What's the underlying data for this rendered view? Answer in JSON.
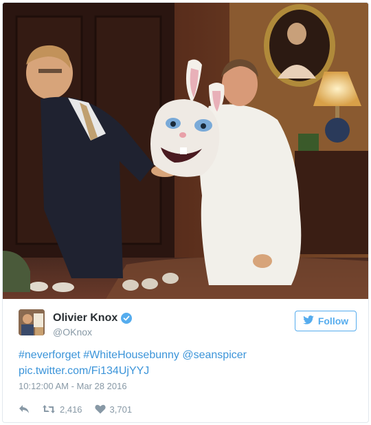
{
  "tweet": {
    "author": {
      "display_name": "Olivier Knox",
      "handle": "@OKnox",
      "verified": true,
      "avatar_icon": "profile-photo"
    },
    "follow_label": "Follow",
    "text": {
      "line1": "#neverforget #WhiteHousebunny @seanspicer",
      "line2": "pic.twitter.com/Fi134UjYYJ"
    },
    "timestamp": "10:12:00 AM - Mar 28 2016",
    "retweets": "2,416",
    "likes": "3,701"
  },
  "icons": {
    "reply": "reply-icon",
    "retweet": "retweet-icon",
    "like": "heart-icon",
    "verified": "verified-badge-icon",
    "twitter_bird": "twitter-bird-icon"
  },
  "colors": {
    "link": "#3b94d9",
    "follow_accent": "#55acee",
    "muted": "#8899a6",
    "text": "#292f33",
    "border": "#e1e8ed"
  }
}
